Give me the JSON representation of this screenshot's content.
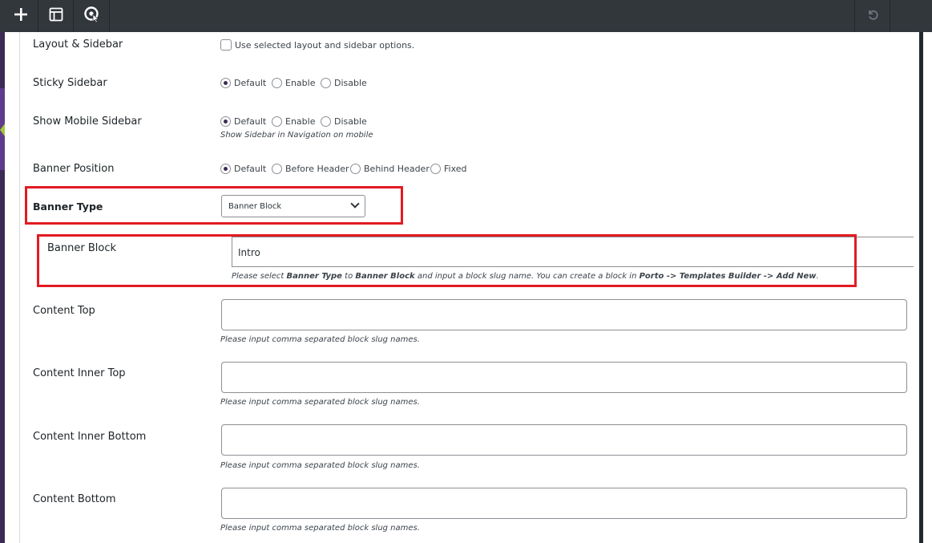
{
  "toolbar": {
    "add_icon": "plus-icon",
    "layout_icon": "layout-icon",
    "porto_icon": "porto-pointer-icon",
    "undo_icon": "undo-icon"
  },
  "fields": {
    "layout_sidebar": {
      "label": "Layout & Sidebar",
      "checkbox_label": "Use selected layout and sidebar options."
    },
    "sticky_sidebar": {
      "label": "Sticky Sidebar",
      "options": [
        "Default",
        "Enable",
        "Disable"
      ],
      "selected": "Default"
    },
    "show_mobile_sidebar": {
      "label": "Show Mobile Sidebar",
      "options": [
        "Default",
        "Enable",
        "Disable"
      ],
      "selected": "Default",
      "help": "Show Sidebar in Navigation on mobile"
    },
    "banner_position": {
      "label": "Banner Position",
      "options": [
        "Default",
        "Before Header",
        "Behind Header",
        "Fixed"
      ],
      "selected": "Default"
    },
    "banner_type": {
      "label": "Banner Type",
      "selected_value": "Banner Block"
    },
    "banner_block": {
      "label": "Banner Block",
      "value": "Intro",
      "help_parts": [
        "Please select ",
        "Banner Type",
        " to ",
        "Banner Block",
        " and input a block slug name. You can create a block in ",
        "Porto -> Templates Builder -> Add New",
        "."
      ]
    },
    "content_top": {
      "label": "Content Top",
      "value": "",
      "help": "Please input comma separated block slug names."
    },
    "content_inner_top": {
      "label": "Content Inner Top",
      "value": "",
      "help": "Please input comma separated block slug names."
    },
    "content_inner_bottom": {
      "label": "Content Inner Bottom",
      "value": "",
      "help": "Please input comma separated block slug names."
    },
    "content_bottom": {
      "label": "Content Bottom",
      "value": "",
      "help": "Please input comma separated block slug names."
    }
  },
  "colors": {
    "highlight": "#e21b23",
    "toolbar": "#32373c",
    "accent": "#5e3c8b"
  }
}
